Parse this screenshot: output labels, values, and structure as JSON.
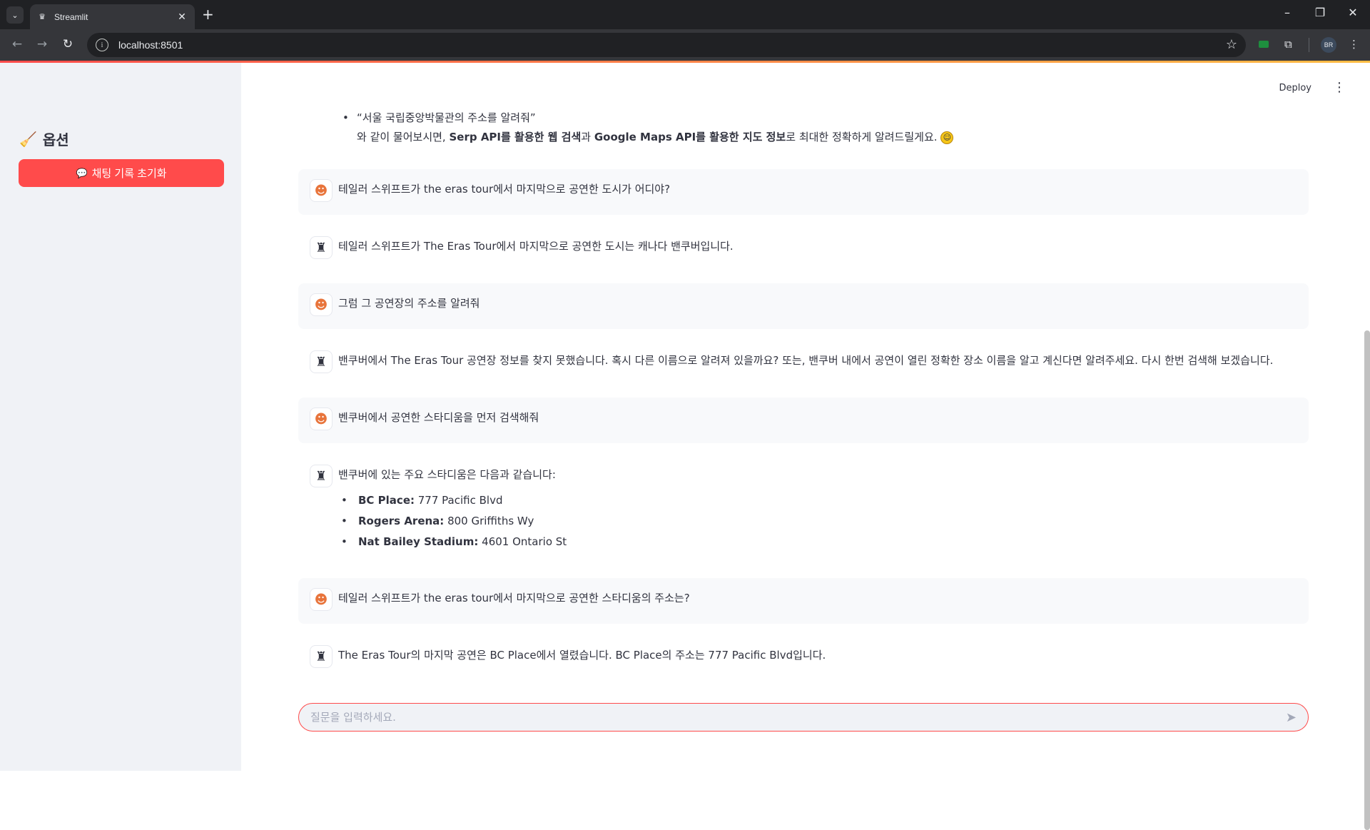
{
  "browser": {
    "tab_title": "Streamlit",
    "url": "localhost:8501",
    "profile_initials": "BR"
  },
  "sidebar": {
    "title": "옵션",
    "reset_button_label": "채팅 기록 초기화"
  },
  "header": {
    "deploy_label": "Deploy"
  },
  "intro": {
    "quote": "“서울 국립중앙박물관의 주소를 알려줘”",
    "line_prefix": "와 같이 물어보시면, ",
    "bold1": "Serp API를 활용한 웹 검색",
    "mid": "과 ",
    "bold2": "Google Maps API를 활용한 지도 정보",
    "suffix": "로 최대한 정확하게 알려드릴게요."
  },
  "messages": [
    {
      "role": "user",
      "text": "테일러 스위프트가 the eras tour에서 마지막으로 공연한 도시가 어디야?"
    },
    {
      "role": "assistant",
      "text": "테일러 스위프트가 The Eras Tour에서 마지막으로 공연한 도시는 캐나다 밴쿠버입니다."
    },
    {
      "role": "user",
      "text": "그럼 그 공연장의 주소를 알려줘"
    },
    {
      "role": "assistant",
      "text": "밴쿠버에서 The Eras Tour 공연장 정보를 찾지 못했습니다. 혹시 다른 이름으로 알려져 있을까요? 또는, 밴쿠버 내에서 공연이 열린 정확한 장소 이름을 알고 계신다면 알려주세요. 다시 한번 검색해 보겠습니다."
    },
    {
      "role": "user",
      "text": "벤쿠버에서 공연한 스타디움을 먼저 검색해줘"
    },
    {
      "role": "assistant",
      "text": "밴쿠버에 있는 주요 스타디움은 다음과 같습니다:",
      "list": [
        {
          "name": "BC Place:",
          "address": "777 Pacific Blvd"
        },
        {
          "name": "Rogers Arena:",
          "address": "800 Griffiths Wy"
        },
        {
          "name": "Nat Bailey Stadium:",
          "address": "4601 Ontario St"
        }
      ]
    },
    {
      "role": "user",
      "text": "테일러 스위프트가 the eras tour에서 마지막으로 공연한 스타디움의 주소는?"
    },
    {
      "role": "assistant",
      "text": "The Eras Tour의 마지막 공연은 BC Place에서 열렸습니다. BC Place의 주소는 777 Pacific Blvd입니다."
    }
  ],
  "chat_input": {
    "placeholder": "질문을 입력하세요."
  },
  "colors": {
    "primary": "#ff4b4b",
    "sidebar_bg": "#f0f2f6",
    "user_msg_bg": "#f8f9fb"
  }
}
